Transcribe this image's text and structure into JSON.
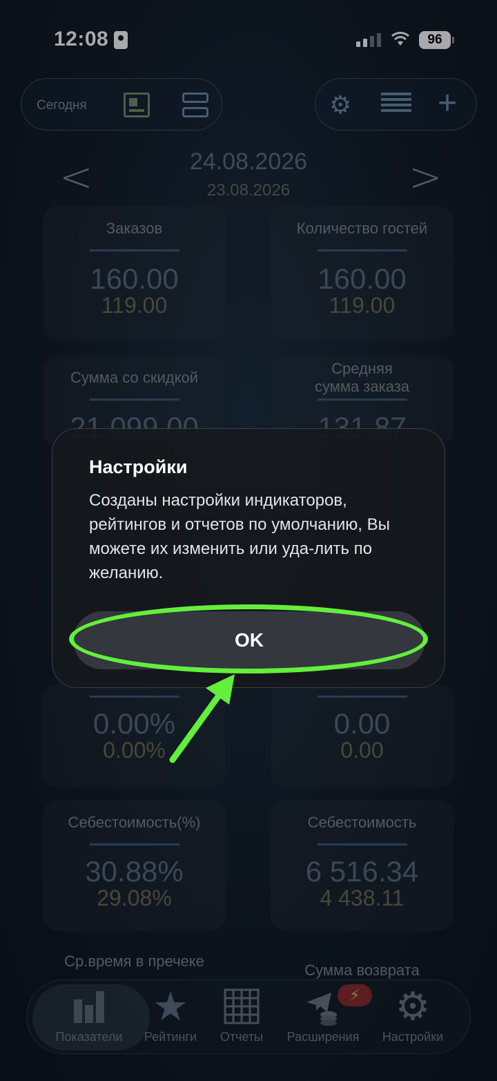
{
  "status_bar": {
    "time": "12:08",
    "battery": "96"
  },
  "toolbar": {
    "today_label": "Сегодня",
    "left_icons": [
      "newspaper-icon",
      "server-icon"
    ],
    "right_icons": [
      "gear-icon",
      "list-icon",
      "plus-icon"
    ]
  },
  "date_nav": {
    "prev_arrow": "<",
    "next_arrow": ">",
    "current_date": "24.08.2026",
    "compare_date": "23.08.2026"
  },
  "cards": [
    {
      "label": "Заказов",
      "current": "160.00",
      "previous": "119.00"
    },
    {
      "label": "Количество гостей",
      "current": "160.00",
      "previous": "119.00"
    },
    {
      "label": "Сумма со скидкой",
      "current": "21 099.00",
      "previous": ""
    },
    {
      "label": "Средняя\nсумма заказа",
      "current": "131.87",
      "previous": ""
    },
    {
      "label": "",
      "current": "0.00%",
      "previous": "0.00%"
    },
    {
      "label": "",
      "current": "0.00",
      "previous": "0.00"
    },
    {
      "label": "Себестоимость(%)",
      "current": "30.88%",
      "previous": "29.08%"
    },
    {
      "label": "Себестоимость",
      "current": "6 516.34",
      "previous": "4 438.11"
    },
    {
      "label": "Ср.время в пречеке",
      "current": "",
      "previous": ""
    },
    {
      "label": "Сумма возврата",
      "current": "",
      "previous": ""
    }
  ],
  "alert": {
    "title": "Настройки",
    "message": "Созданы настройки индикаторов, рейтингов и отчетов по умолчанию, Вы можете их изменить или уда-лить по желанию.",
    "ok_label": "OK"
  },
  "tabbar": {
    "items": [
      {
        "label": "Показатели",
        "icon": "chart-bars-icon",
        "active": true
      },
      {
        "label": "Рейтинги",
        "icon": "star-icon",
        "active": false
      },
      {
        "label": "Отчеты",
        "icon": "grid-icon",
        "active": false
      },
      {
        "label": "Расширения",
        "icon": "telegram-coins-icon",
        "active": false
      },
      {
        "label": "Настройки",
        "icon": "gear-icon",
        "active": false
      }
    ],
    "badge": "⚡"
  },
  "colors": {
    "annotation": "#63f03c",
    "value_current": "#56697d",
    "value_previous": "#6c6a4e"
  }
}
